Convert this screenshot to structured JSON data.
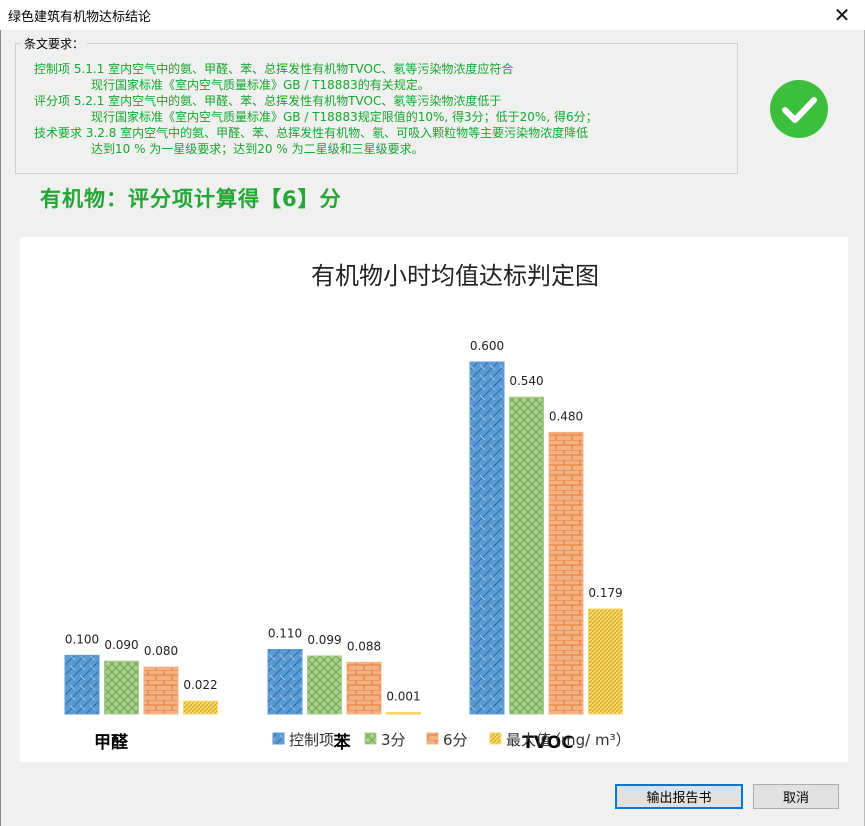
{
  "window": {
    "title": "绿色建筑有机物达标结论",
    "close_glyph": "✕"
  },
  "requirements": {
    "label": "条文要求：",
    "lines": [
      "控制项   5.1.1 室内空气中的氨、甲醛、苯、总挥发性有机物TVOC、氡等污染物浓度应符合",
      "现行国家标准《室内空气质量标准》GB / T18883的有关规定。",
      "评分项   5.2.1 室内空气中的氨、甲醛、苯、总挥发性有机物TVOC、氡等污染物浓度低于",
      "现行国家标准《室内空气质量标准》GB / T18883规定限值的10%, 得3分；低于20%, 得6分；",
      "技术要求 3.2.8 室内空气中的氨、甲醛、苯、总挥发性有机物、氡、可吸入颗粒物等主要污染物浓度降低",
      "达到10 % 为一星级要求；达到20 % 为二星级和三星级要求。"
    ]
  },
  "status_icon": "check-circle-icon",
  "score_text": "有机物：评分项计算得【6】分",
  "chart_data": {
    "type": "bar",
    "title": "有机物小时均值达标判定图",
    "categories": [
      "甲醛",
      "苯",
      "TVOC"
    ],
    "series": [
      {
        "name": "控制项",
        "values": [
          0.1,
          0.11,
          0.6
        ],
        "color": "#5b9bd5"
      },
      {
        "name": "3分",
        "values": [
          0.09,
          0.099,
          0.54
        ],
        "color": "#a9d18e"
      },
      {
        "name": "6分",
        "values": [
          0.08,
          0.088,
          0.48
        ],
        "color": "#f4b183"
      },
      {
        "name": "最大值",
        "values": [
          0.022,
          0.001,
          0.179
        ],
        "color": "#ffd966"
      }
    ],
    "value_labels": [
      [
        "0.100",
        "0.090",
        "0.080",
        "0.022"
      ],
      [
        "0.110",
        "0.099",
        "0.088",
        "0.001"
      ],
      [
        "0.600",
        "0.540",
        "0.480",
        "0.179"
      ]
    ],
    "unit_label": "（mg/ m³）",
    "legend_position": "bottom",
    "ylim": [
      0,
      0.6
    ],
    "grid": false
  },
  "buttons": {
    "export": "输出报告书",
    "cancel": "取消"
  }
}
